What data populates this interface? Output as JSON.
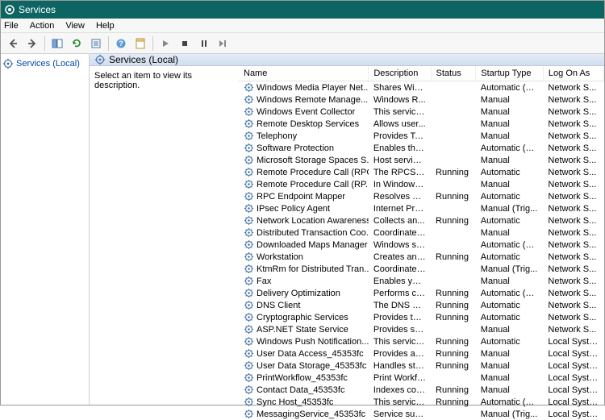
{
  "window": {
    "title": "Services"
  },
  "menu": {
    "file": "File",
    "action": "Action",
    "view": "View",
    "help": "Help"
  },
  "nav": {
    "root": "Services (Local)"
  },
  "content": {
    "header": "Services (Local)",
    "desc_prompt": "Select an item to view its description."
  },
  "columns": {
    "name": "Name",
    "description": "Description",
    "status": "Status",
    "startup": "Startup Type",
    "logon": "Log On As"
  },
  "services": [
    {
      "name": "Windows Media Player Net...",
      "desc": "Shares Win...",
      "status": "",
      "startup": "Automatic (D...",
      "logon": "Network S..."
    },
    {
      "name": "Windows Remote Manage...",
      "desc": "Windows R...",
      "status": "",
      "startup": "Manual",
      "logon": "Network S..."
    },
    {
      "name": "Windows Event Collector",
      "desc": "This service ...",
      "status": "",
      "startup": "Manual",
      "logon": "Network S..."
    },
    {
      "name": "Remote Desktop Services",
      "desc": "Allows user...",
      "status": "",
      "startup": "Manual",
      "logon": "Network S..."
    },
    {
      "name": "Telephony",
      "desc": "Provides Tel...",
      "status": "",
      "startup": "Manual",
      "logon": "Network S..."
    },
    {
      "name": "Software Protection",
      "desc": "Enables the ...",
      "status": "",
      "startup": "Automatic (D...",
      "logon": "Network S..."
    },
    {
      "name": "Microsoft Storage Spaces S...",
      "desc": "Host service...",
      "status": "",
      "startup": "Manual",
      "logon": "Network S..."
    },
    {
      "name": "Remote Procedure Call (RPC)",
      "desc": "The RPCSS s...",
      "status": "Running",
      "startup": "Automatic",
      "logon": "Network S..."
    },
    {
      "name": "Remote Procedure Call (RP...",
      "desc": "In Windows...",
      "status": "",
      "startup": "Manual",
      "logon": "Network S..."
    },
    {
      "name": "RPC Endpoint Mapper",
      "desc": "Resolves RP...",
      "status": "Running",
      "startup": "Automatic",
      "logon": "Network S..."
    },
    {
      "name": "IPsec Policy Agent",
      "desc": "Internet Pro...",
      "status": "",
      "startup": "Manual (Trig...",
      "logon": "Network S..."
    },
    {
      "name": "Network Location Awareness",
      "desc": "Collects an...",
      "status": "Running",
      "startup": "Automatic",
      "logon": "Network S..."
    },
    {
      "name": "Distributed Transaction Coo...",
      "desc": "Coordinates...",
      "status": "",
      "startup": "Manual",
      "logon": "Network S..."
    },
    {
      "name": "Downloaded Maps Manager",
      "desc": "Windows se...",
      "status": "",
      "startup": "Automatic (D...",
      "logon": "Network S..."
    },
    {
      "name": "Workstation",
      "desc": "Creates and...",
      "status": "Running",
      "startup": "Automatic",
      "logon": "Network S..."
    },
    {
      "name": "KtmRm for Distributed Tran...",
      "desc": "Coordinates...",
      "status": "",
      "startup": "Manual (Trig...",
      "logon": "Network S..."
    },
    {
      "name": "Fax",
      "desc": "Enables you...",
      "status": "",
      "startup": "Manual",
      "logon": "Network S..."
    },
    {
      "name": "Delivery Optimization",
      "desc": "Performs co...",
      "status": "Running",
      "startup": "Automatic (D...",
      "logon": "Network S..."
    },
    {
      "name": "DNS Client",
      "desc": "The DNS Cli...",
      "status": "Running",
      "startup": "Automatic",
      "logon": "Network S..."
    },
    {
      "name": "Cryptographic Services",
      "desc": "Provides thr...",
      "status": "Running",
      "startup": "Automatic",
      "logon": "Network S..."
    },
    {
      "name": "ASP.NET State Service",
      "desc": "Provides su...",
      "status": "",
      "startup": "Manual",
      "logon": "Network S..."
    },
    {
      "name": "Windows Push Notification...",
      "desc": "This service ...",
      "status": "Running",
      "startup": "Automatic",
      "logon": "Local Syste..."
    },
    {
      "name": "User Data Access_45353fc",
      "desc": "Provides ap...",
      "status": "Running",
      "startup": "Manual",
      "logon": "Local Syste..."
    },
    {
      "name": "User Data Storage_45353fc",
      "desc": "Handles sto...",
      "status": "Running",
      "startup": "Manual",
      "logon": "Local Syste..."
    },
    {
      "name": "PrintWorkflow_45353fc",
      "desc": "Print Workfl...",
      "status": "",
      "startup": "Manual",
      "logon": "Local Syste..."
    },
    {
      "name": "Contact Data_45353fc",
      "desc": "Indexes con...",
      "status": "Running",
      "startup": "Manual",
      "logon": "Local Syste..."
    },
    {
      "name": "Sync Host_45353fc",
      "desc": "This service ...",
      "status": "Running",
      "startup": "Automatic (D...",
      "logon": "Local Syste..."
    },
    {
      "name": "MessagingService_45353fc",
      "desc": "Service sup...",
      "status": "",
      "startup": "Manual (Trig...",
      "logon": "Local Syste..."
    }
  ]
}
